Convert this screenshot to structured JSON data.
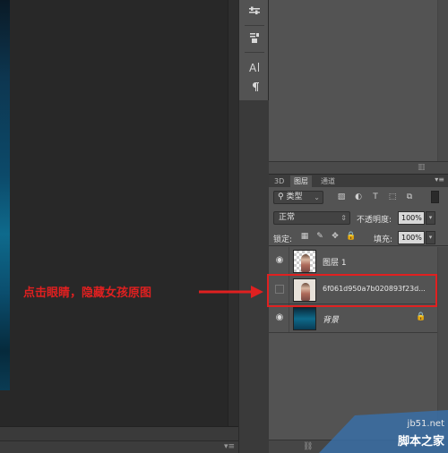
{
  "tools": {
    "items": [
      "adjustments-icon",
      "properties-icon",
      "character-icon",
      "paragraph-icon"
    ]
  },
  "layers_panel": {
    "tabs": [
      {
        "label": "3D",
        "active": false
      },
      {
        "label": "图层",
        "active": true
      },
      {
        "label": "通道",
        "active": false
      }
    ],
    "filter_kind": "类型",
    "blend_mode": "正常",
    "opacity_label": "不透明度:",
    "opacity_value": "100%",
    "lock_label": "锁定:",
    "fill_label": "填充:",
    "fill_value": "100%",
    "layers": [
      {
        "name": "图层 1",
        "visible": true,
        "thumb": "girl-checker",
        "locked": false,
        "italic": false
      },
      {
        "name": "6f061d950a7b020893f23d...",
        "visible": false,
        "thumb": "girl-photo",
        "locked": false,
        "italic": false
      },
      {
        "name": "背景",
        "visible": true,
        "thumb": "ocean",
        "locked": true,
        "italic": true
      }
    ]
  },
  "annotation": {
    "text": "点击眼睛，隐藏女孩原图",
    "color": "#e02020"
  },
  "watermark": {
    "url": "jb51.net",
    "name": "脚本之家"
  }
}
